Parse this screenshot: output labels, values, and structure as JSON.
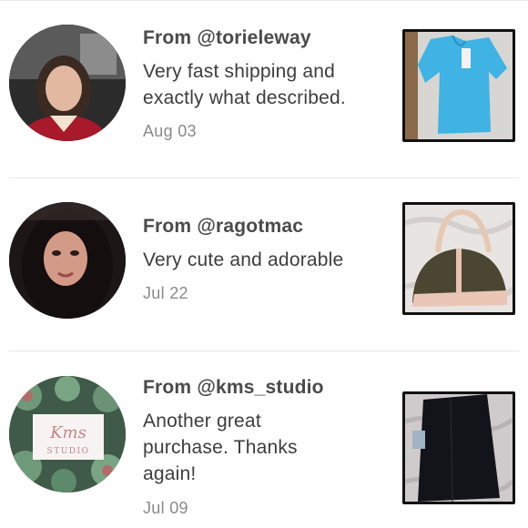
{
  "reviews": [
    {
      "from": "From @torieleway",
      "text": "Very fast shipping and exactly what described.",
      "date": "Aug 03",
      "avatar_icon": "user-photo-woman-in-car",
      "item_icon": "blue-top-photo"
    },
    {
      "from": "From @ragotmac",
      "text": "Very cute and adorable",
      "date": "Jul 22",
      "avatar_icon": "user-photo-dark-hair",
      "item_icon": "handbag-photo"
    },
    {
      "from": "From @kms_studio",
      "text": "Another great purchase. Thanks again!",
      "date": "Jul 09",
      "avatar_icon": "kms-studio-logo",
      "avatar_logo": {
        "script": "Kms",
        "word": "STUDIO"
      },
      "item_icon": "black-skirt-photo"
    }
  ],
  "colors": {
    "text": "#3d3d3d",
    "username": "#4a4a4a",
    "date": "#8a8a8a",
    "separator": "#e8e8e8"
  }
}
